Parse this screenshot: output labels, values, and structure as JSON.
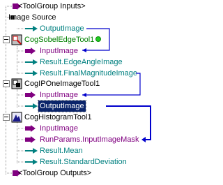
{
  "tree": {
    "toolgroup_inputs": "<ToolGroup Inputs>",
    "image_source": "Image Source",
    "image_source_output": "OutputImage",
    "sobel_tool": "CogSobelEdgeTool1",
    "sobel_input": "InputImage",
    "sobel_edge_angle": "Result.EdgeAngleImage",
    "sobel_final_mag": "Result.FinalMagnitudeImage",
    "ipone_tool": "CogIPOneImageTool1",
    "ipone_input": "InputImage",
    "ipone_output": "OutputImage",
    "hist_tool": "CogHistogramTool1",
    "hist_input": "InputImage",
    "hist_mask": "RunParams.InputImageMask",
    "hist_mean": "Result.Mean",
    "hist_stddev": "Result.StandardDeviation",
    "toolgroup_outputs": "<ToolGroup Outputs>"
  },
  "colors": {
    "link_line": "#0000cc",
    "input_terminal": "#800080",
    "output_terminal": "#008080",
    "selected_bg": "#0a246a",
    "status_ok": "#22cc22"
  }
}
